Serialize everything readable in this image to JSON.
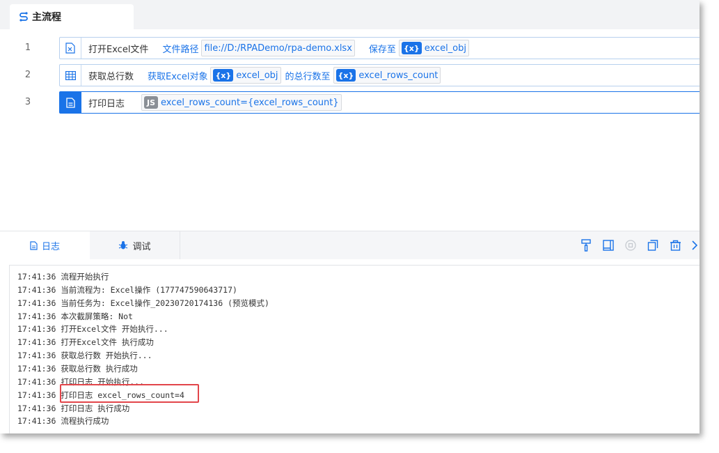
{
  "tab": {
    "title": "主流程",
    "icon": "flow-icon"
  },
  "rows": [
    {
      "line": "1",
      "icon": "excel-file-icon",
      "name": "打开Excel文件",
      "label1": "文件路径",
      "path": "file://D:/RPADemo/rpa-demo.xlsx",
      "label2": "保存至",
      "var_badge": "{x}",
      "var": "excel_obj"
    },
    {
      "line": "2",
      "icon": "table-grid-icon",
      "name": "获取总行数",
      "label1": "获取Excel对象",
      "var_badge1": "{x}",
      "var1": "excel_obj",
      "label2": "的总行数至",
      "var_badge2": "{x}",
      "var2": "excel_rows_count"
    },
    {
      "line": "3",
      "icon": "document-icon",
      "name": "打印日志",
      "js_badge": "JS",
      "expr": "excel_rows_count={excel_rows_count}"
    }
  ],
  "panel": {
    "tabs": [
      {
        "label": "日志",
        "icon": "document-icon"
      },
      {
        "label": "调试",
        "icon": "bug-icon"
      }
    ],
    "tools": [
      "brush-icon",
      "panel-icon",
      "stop-icon",
      "copy-icon",
      "trash-icon",
      "chevron-right-icon"
    ]
  },
  "log": [
    {
      "time": "17:41:36",
      "msg": "流程开始执行"
    },
    {
      "time": "17:41:36",
      "msg": "当前流程为: Excel操作 (177747590643717)"
    },
    {
      "time": "17:41:36",
      "msg": "当前任务为: Excel操作_20230720174136 (预览模式)"
    },
    {
      "time": "17:41:36",
      "msg": "本次截屏策略: Not"
    },
    {
      "time": "17:41:36",
      "msg": "打开Excel文件 开始执行..."
    },
    {
      "time": "17:41:36",
      "msg": "打开Excel文件 执行成功"
    },
    {
      "time": "17:41:36",
      "msg": "获取总行数 开始执行..."
    },
    {
      "time": "17:41:36",
      "msg": "获取总行数 执行成功"
    },
    {
      "time": "17:41:36",
      "msg": "打印日志 开始执行..."
    },
    {
      "time": "17:41:36",
      "msg": "打印日志 excel_rows_count=4"
    },
    {
      "time": "17:41:36",
      "msg": "打印日志 执行成功"
    },
    {
      "time": "17:41:36",
      "msg": "流程执行成功"
    }
  ],
  "colors": {
    "accent": "#1a73e8",
    "highlight": "#e2454a"
  }
}
